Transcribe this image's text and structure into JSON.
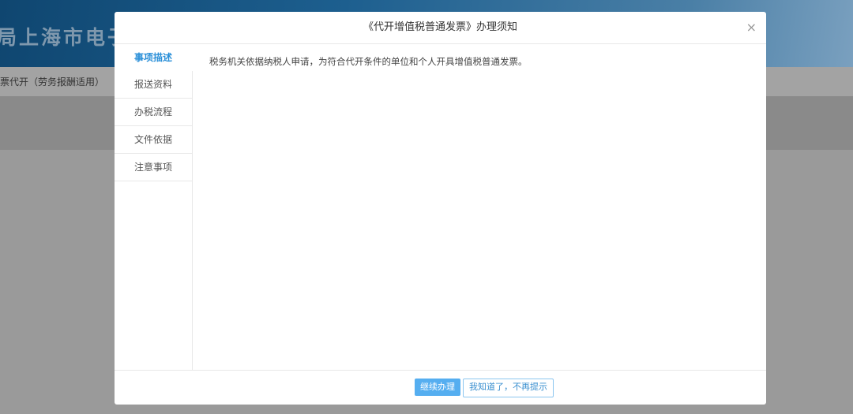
{
  "background": {
    "banner_title": "局上海市电子税",
    "subnav": "票代开（劳务报酬适用）"
  },
  "modal": {
    "title": "《代开增值税普通发票》办理须知",
    "close": "×",
    "tabs": [
      {
        "label": "事项描述"
      },
      {
        "label": "报送资料"
      },
      {
        "label": "办税流程"
      },
      {
        "label": "文件依据"
      },
      {
        "label": "注意事项"
      }
    ],
    "content": "税务机关依据纳税人申请，为符合代开条件的单位和个人开具增值税普通发票。",
    "continue_button": "继续办理",
    "dismiss_button": "我知道了，不再提示"
  }
}
